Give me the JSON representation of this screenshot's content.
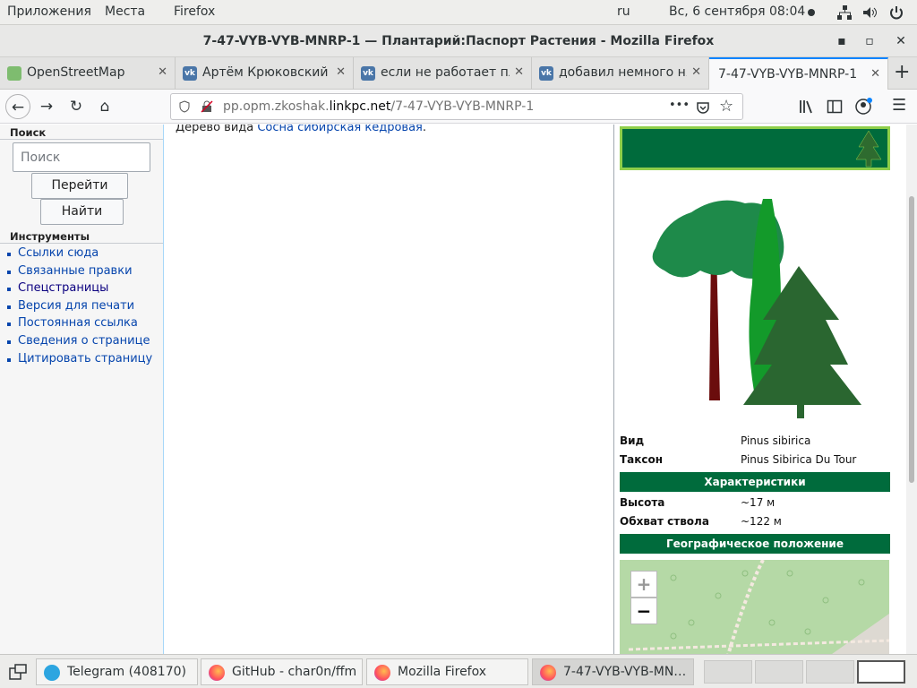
{
  "topbar": {
    "apps": "Приложения",
    "places": "Места",
    "firefox": "Firefox",
    "lang": "ru",
    "datetime": "Вс, 6 сентября  08:04"
  },
  "window": {
    "title": "7-47-VYB-VYB-MNRP-1 — Плантарий:Паспорт Растения - Mozilla Firefox",
    "minimize": "▪",
    "maximize": "▫",
    "close": "✕"
  },
  "tabs": [
    {
      "label": "OpenStreetMap",
      "icon": "osm-icon"
    },
    {
      "label": "Артём Крюковский",
      "icon": "vk-icon"
    },
    {
      "label": "если не работает пл",
      "icon": "vk-icon"
    },
    {
      "label": "добавил немного ня",
      "icon": "vk-icon"
    },
    {
      "label": "7-47-VYB-VYB-MNRP-1",
      "icon": ""
    }
  ],
  "navbar": {
    "url_prefix": "pp.opm.zkoshak.",
    "url_domain": "linkpc.net",
    "url_path": "/7-47-VYB-VYB-MNRP-1",
    "dots": "•••"
  },
  "sidebar": {
    "search_heading": "Поиск",
    "search_placeholder": "Поиск",
    "go_button": "Перейти",
    "find_button": "Найти",
    "tools_heading": "Инструменты",
    "tools": [
      "Ссылки сюда",
      "Связанные правки",
      "Спецстраницы",
      "Версия для печати",
      "Постоянная ссылка",
      "Сведения о странице",
      "Цитировать страницу"
    ]
  },
  "main": {
    "text_prefix": "Дерево вида ",
    "link": "Сосна сибирская кедровая",
    "text_suffix": "."
  },
  "infobox": {
    "species_label": "Вид",
    "species_value": "Pinus sibirica",
    "taxon_label": "Таксон",
    "taxon_value": "Pinus Sibirica Du Tour",
    "characteristics": "Характеристики",
    "height_label": "Высота",
    "height_value": "~17 м",
    "girth_label": "Обхват ствола",
    "girth_value": "~122 м",
    "geo": "Географическое положение",
    "zoom_in": "+",
    "zoom_out": "−"
  },
  "taskbar": [
    {
      "label": "Telegram (408170)",
      "icon": "telegram-icon"
    },
    {
      "label": "GitHub - char0n/ffm…",
      "icon": "firefox-icon"
    },
    {
      "label": "Mozilla Firefox",
      "icon": "firefox-icon"
    },
    {
      "label": "7-47-VYB-VYB-MN…",
      "icon": "firefox-icon"
    }
  ],
  "colors": {
    "accent": "#0a84ff",
    "infobox_green": "#006b3c",
    "banner_border": "#8fcf4a",
    "link": "#0645ad"
  }
}
